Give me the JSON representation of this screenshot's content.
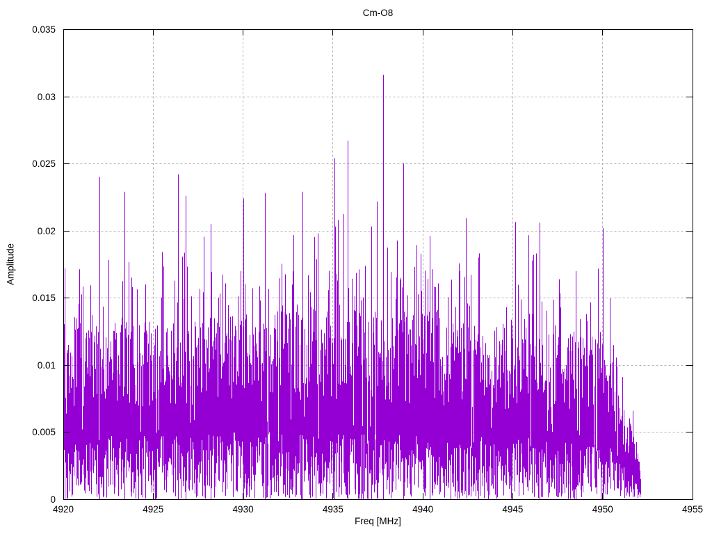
{
  "chart_data": {
    "type": "line",
    "style": "dense-impulse-noise-spectrum",
    "title": "Cm-O8",
    "xlabel": "Freq [MHz]",
    "ylabel": "Amplitude",
    "xlim": [
      4920,
      4955
    ],
    "ylim": [
      0,
      0.035
    ],
    "xticks": [
      4920,
      4925,
      4930,
      4935,
      4940,
      4945,
      4950,
      4955
    ],
    "yticks": [
      0,
      0.005,
      0.01,
      0.015,
      0.02,
      0.025,
      0.03,
      0.035
    ],
    "grid": true,
    "legend": "none",
    "series_color": "#9400d3",
    "grid_color": "#b0b0b0",
    "frame_color": "#000000",
    "data_freq_range": [
      4920.0,
      4952.1
    ],
    "noise_envelope": {
      "freq": [
        4920,
        4922,
        4926,
        4930,
        4934,
        4938,
        4942,
        4946,
        4949,
        4950.3,
        4951,
        4951.7,
        4952.1
      ],
      "core_top": [
        0.0115,
        0.0125,
        0.0125,
        0.013,
        0.0135,
        0.013,
        0.0125,
        0.012,
        0.0115,
        0.011,
        0.007,
        0.0045,
        0.002
      ],
      "description": "dense noise band: solid violet from ~0.001 up to ~0.009, ragged minima 0-0.005, frequent spikes to ~0.016, occasional spikes to ~0.021, sharp roll-off after 4950.3 MHz ending at ~4952.1 MHz"
    },
    "noise_model": {
      "seed": 42,
      "low_col_prob": 0.05,
      "spike_prob": 0.4,
      "spike_max": 0.0085,
      "top_base": 0.55,
      "top_span": 0.52,
      "min_max": 0.005
    },
    "notable_peaks": [
      {
        "freq": 4920.06,
        "amp": 0.0172
      },
      {
        "freq": 4922.0,
        "amp": 0.024
      },
      {
        "freq": 4923.4,
        "amp": 0.0229
      },
      {
        "freq": 4926.4,
        "amp": 0.0242
      },
      {
        "freq": 4926.8,
        "amp": 0.0226
      },
      {
        "freq": 4928.2,
        "amp": 0.0205
      },
      {
        "freq": 4930.0,
        "amp": 0.0224
      },
      {
        "freq": 4931.2,
        "amp": 0.0228
      },
      {
        "freq": 4933.3,
        "amp": 0.0229
      },
      {
        "freq": 4935.1,
        "amp": 0.0254
      },
      {
        "freq": 4935.8,
        "amp": 0.0267
      },
      {
        "freq": 4937.8,
        "amp": 0.0316
      },
      {
        "freq": 4938.9,
        "amp": 0.025
      },
      {
        "freq": 4940.4,
        "amp": 0.0196
      },
      {
        "freq": 4943.1,
        "amp": 0.018
      },
      {
        "freq": 4946.5,
        "amp": 0.0206
      },
      {
        "freq": 4948.5,
        "amp": 0.017
      },
      {
        "freq": 4950.0,
        "amp": 0.0202
      }
    ]
  }
}
